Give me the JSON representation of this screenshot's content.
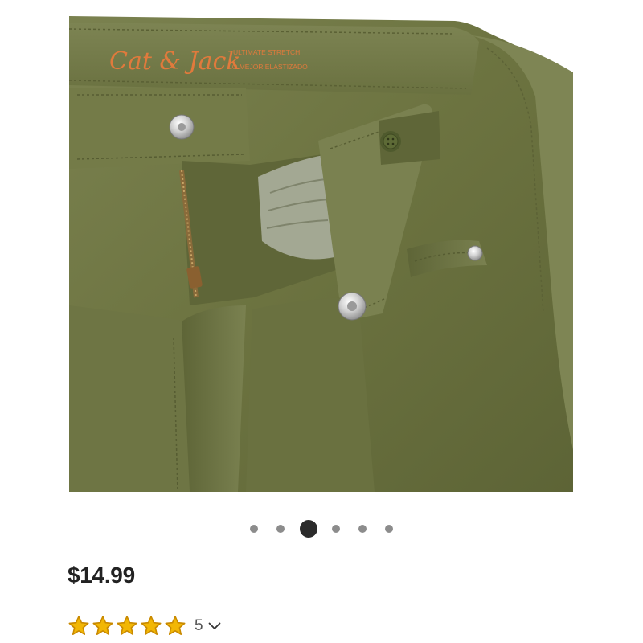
{
  "product": {
    "image": {
      "brand_logo_text": "Cat & Jack",
      "tag_line_1": "ULTIMATE STRETCH",
      "tag_line_2": "LO MEJOR ELASTIZADO",
      "fabric_color": "#6d7442"
    },
    "favorite_icon": "heart-icon",
    "price": "$14.99",
    "rating": {
      "stars": 5,
      "max_stars": 5,
      "count_label": "5",
      "star_color": "#f2b705",
      "star_outline_color": "#c98a00"
    }
  },
  "carousel": {
    "total": 6,
    "active_index": 2
  }
}
